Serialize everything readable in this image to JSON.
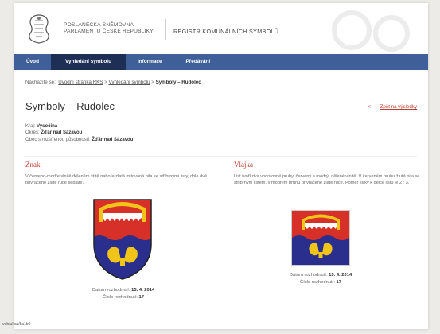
{
  "header": {
    "org_line1": "POSLANECKÁ SNĚMOVNA",
    "org_line2": "PARLAMENTU ČESKÉ REPUBLIKY",
    "register_title": "REGISTR KOMUNÁLNÍCH SYMBOLŮ"
  },
  "nav": {
    "items": [
      {
        "label": "Úvod"
      },
      {
        "label": "Vyhledání symbolu"
      },
      {
        "label": "Informace"
      },
      {
        "label": "Předávání"
      }
    ]
  },
  "breadcrumb": {
    "prefix": "Nacházíte se:",
    "items": [
      "Úvodní stránka RKS",
      "Vyhledání symbolu"
    ],
    "separator": ">",
    "current": "Symboly – Rudolec"
  },
  "page_title": "Symboly – Rudolec",
  "back": {
    "arrow": "<",
    "label": "Zpět na výsledky"
  },
  "meta": {
    "kraj_label": "Kraj:",
    "kraj_value": "Vysočina",
    "okres_label": "Okres:",
    "okres_value": "Žďár nad Sázavou",
    "obec_label": "Obec s rozšířenou působností:",
    "obec_value": "Žďár nad Sázavou"
  },
  "znak": {
    "title": "Znak",
    "text": "V červeno-modře vlnitě děleném štítě nahoře zlatá mitovaná pila se stříbrnými listy, dole dvě přivrácené zlaté ruce sepjaté.",
    "date_label": "Datum rozhodnutí:",
    "date_value": "15. 4. 2014",
    "number_label": "Číslo rozhodnutí:",
    "number_value": "17"
  },
  "vlajka": {
    "title": "Vlajka",
    "text": "List tvoří dva vodorovné pruhy, červený a modrý, dělené vlnitě. V červeném pruhu žlutá pila se stříbrným listem, v modrém pruhu přivrácené zlaté ruce. Poměr šířky k délce listu je 2 : 3.",
    "date_label": "Datum rozhodnutí:",
    "date_value": "15. 4. 2014",
    "number_label": "Číslo rozhodnutí:",
    "number_value": "17"
  },
  "footer": {
    "url_fragment": "web/ukaz/8a1b0"
  },
  "colors": {
    "nav_bg": "#3f5f99",
    "nav_active": "#1e2f55",
    "accent_red": "#c0392b",
    "arms_red": "#d63028",
    "arms_blue": "#2a2e8c",
    "arms_gold": "#f0c419"
  }
}
